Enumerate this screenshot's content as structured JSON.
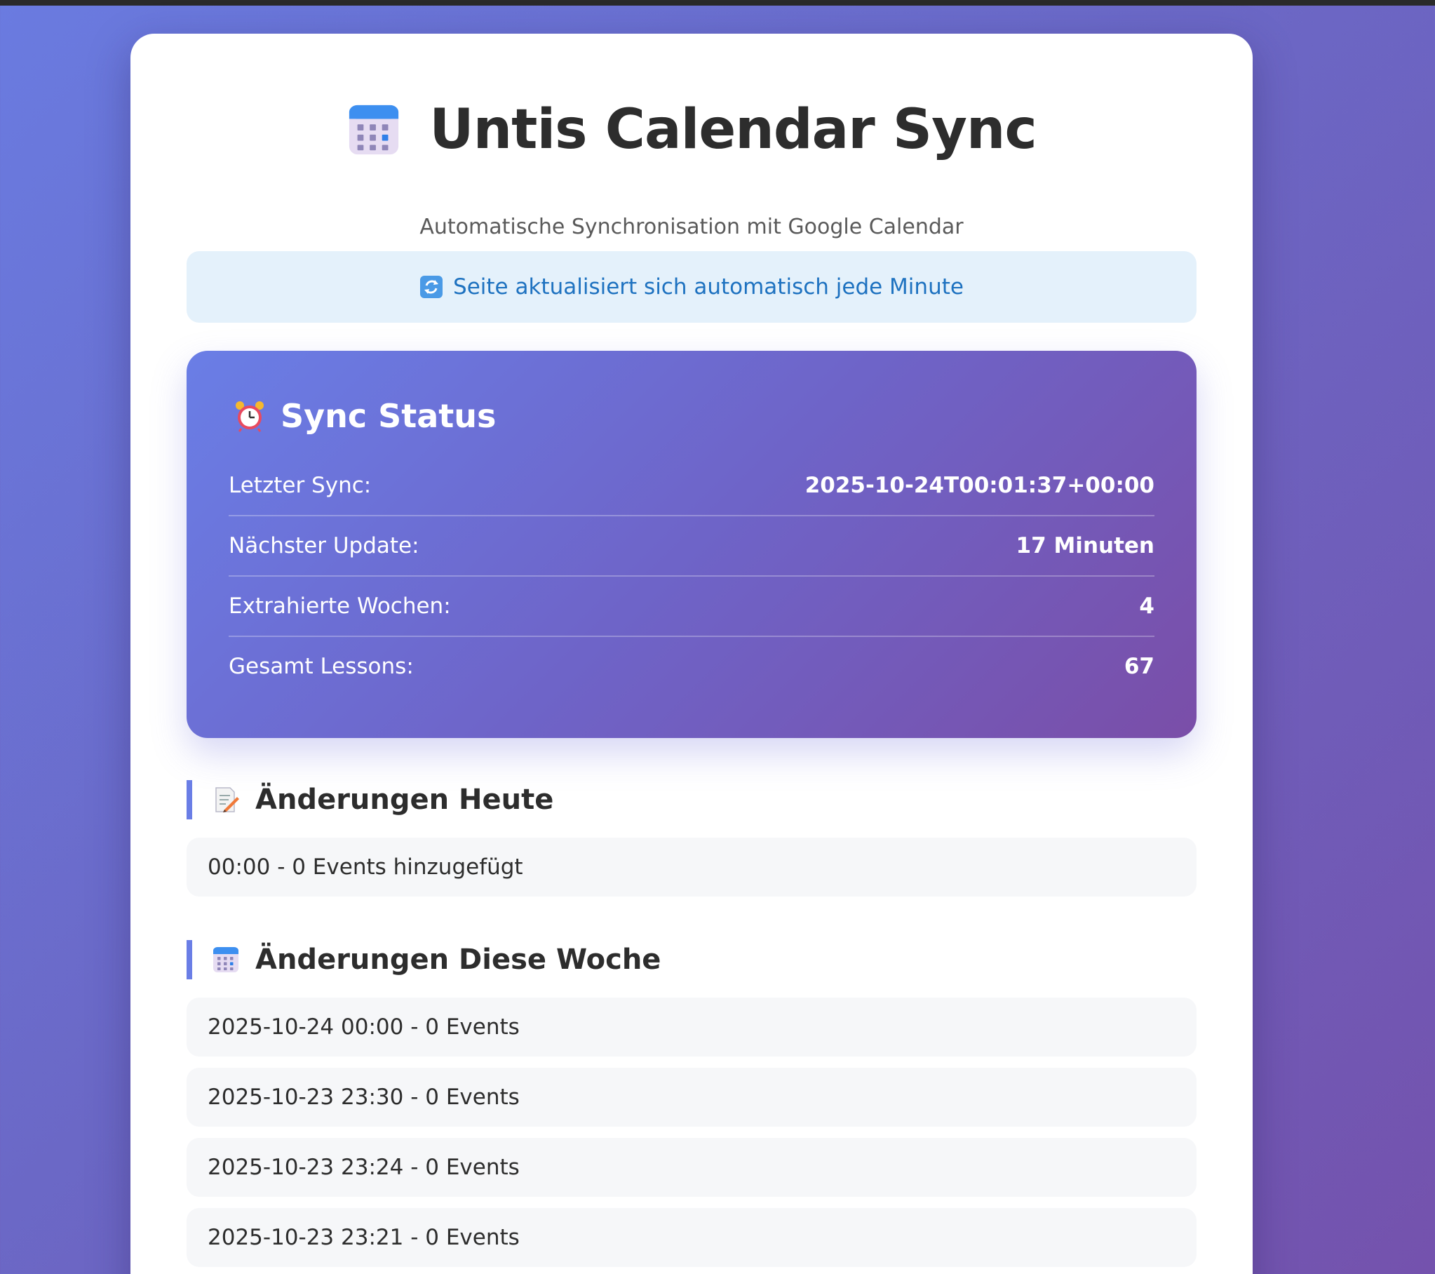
{
  "header": {
    "title": "Untis Calendar Sync",
    "subtitle": "Automatische Synchronisation mit Google Calendar",
    "icon": "calendar-icon"
  },
  "banner": {
    "text": "Seite aktualisiert sich automatisch jede Minute",
    "icon": "refresh-icon"
  },
  "status": {
    "title": "Sync Status",
    "icon": "alarm-clock-icon",
    "rows": [
      {
        "label": "Letzter Sync:",
        "value": "2025-10-24T00:01:37+00:00"
      },
      {
        "label": "Nächster Update:",
        "value": "17 Minuten"
      },
      {
        "label": "Extrahierte Wochen:",
        "value": "4"
      },
      {
        "label": "Gesamt Lessons:",
        "value": "67"
      }
    ]
  },
  "today": {
    "title": "Änderungen Heute",
    "icon": "memo-icon",
    "entries": [
      "00:00 - 0 Events hinzugefügt"
    ]
  },
  "week": {
    "title": "Änderungen Diese Woche",
    "icon": "calendar-icon",
    "entries": [
      "2025-10-24 00:00 - 0 Events",
      "2025-10-23 23:30 - 0 Events",
      "2025-10-23 23:24 - 0 Events",
      "2025-10-23 23:21 - 0 Events"
    ]
  },
  "colors": {
    "accent": "#6a7ee6",
    "banner_text": "#1e72c0",
    "banner_bg": "#e4f1fb"
  }
}
